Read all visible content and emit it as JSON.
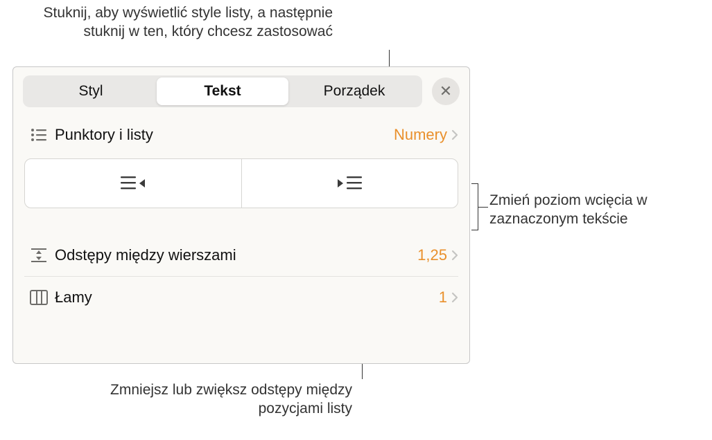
{
  "callouts": {
    "top": "Stuknij, aby wyświetlić style listy, a następnie stuknij w ten, który chcesz zastosować",
    "right": "Zmień poziom wcięcia w zaznaczonym tekście",
    "bottom": "Zmniejsz lub zwiększ odstępy między pozycjami listy"
  },
  "tabs": {
    "style": "Styl",
    "text": "Tekst",
    "arrange": "Porządek"
  },
  "rows": {
    "bullets": {
      "label": "Punktory i listy",
      "value": "Numery"
    },
    "lineSpacing": {
      "label": "Odstępy między wierszami",
      "value": "1,25"
    },
    "columns": {
      "label": "Łamy",
      "value": "1"
    }
  },
  "icons": {
    "close": "✕"
  }
}
